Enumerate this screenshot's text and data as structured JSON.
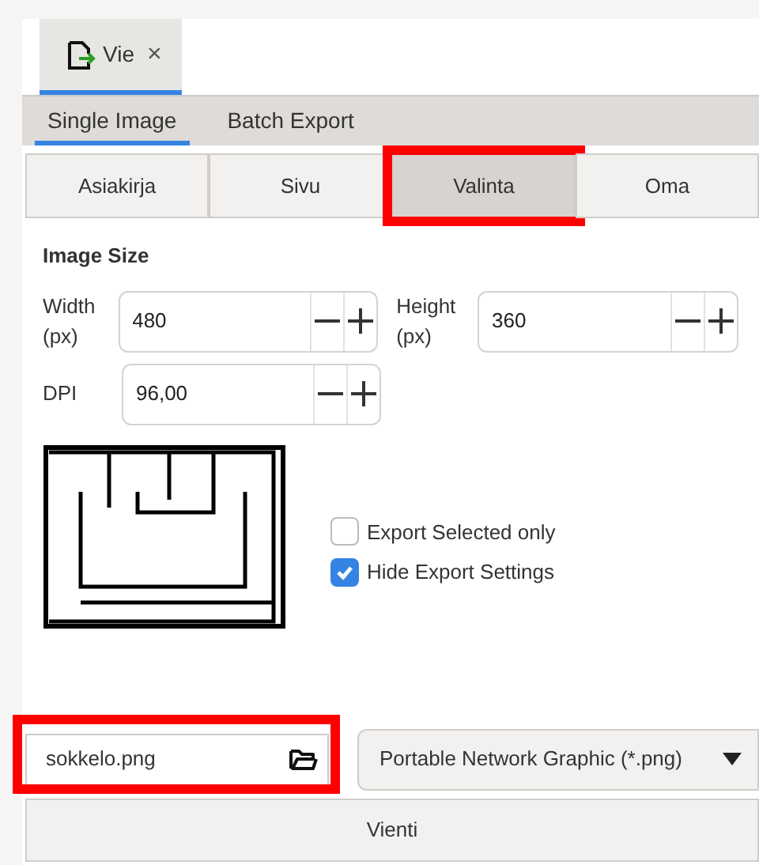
{
  "document_tab": {
    "label": "Vie",
    "close": "×",
    "selected": true
  },
  "mode_tabs": [
    {
      "label": "Single Image",
      "selected": true
    },
    {
      "label": "Batch Export",
      "selected": false
    }
  ],
  "area_buttons": [
    {
      "label": "Asiakirja",
      "selected": false,
      "highlighted": false
    },
    {
      "label": "Sivu",
      "selected": false,
      "highlighted": false
    },
    {
      "label": "Valinta",
      "selected": true,
      "highlighted": true
    },
    {
      "label": "Oma",
      "selected": false,
      "highlighted": false
    }
  ],
  "image_size": {
    "heading": "Image Size",
    "width": {
      "label": "Width (px)",
      "value": "480"
    },
    "height": {
      "label": "Height (px)",
      "value": "360"
    },
    "dpi": {
      "label": "DPI",
      "value": "96,00"
    }
  },
  "options": [
    {
      "label": "Export Selected only",
      "checked": false
    },
    {
      "label": "Hide Export Settings",
      "checked": true
    }
  ],
  "filename": {
    "value": "sokkelo.png",
    "highlighted": true
  },
  "format": {
    "value": "Portable Network Graphic (*.png)"
  },
  "export_button": "Vienti"
}
